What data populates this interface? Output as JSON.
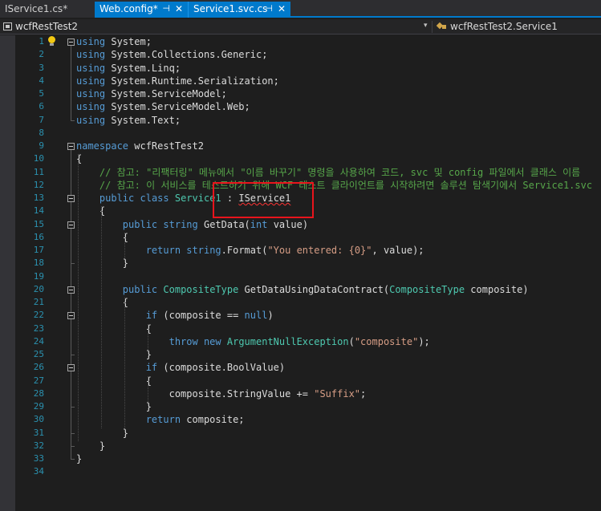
{
  "tabs": [
    {
      "label": "IService1.cs*"
    },
    {
      "label": "Web.config*",
      "pin": "⊣",
      "close": "✕"
    },
    {
      "label": "Service1.svc.cs",
      "pin": "⊣",
      "close": "✕"
    }
  ],
  "navbar": {
    "project": "wcfRestTest2",
    "member": "wcfRestTest2.Service1",
    "dropdown_glyph": "▾"
  },
  "editor": {
    "line_numbers": [
      "1",
      "2",
      "3",
      "4",
      "5",
      "6",
      "7",
      "8",
      "9",
      "10",
      "11",
      "12",
      "13",
      "14",
      "15",
      "16",
      "17",
      "18",
      "19",
      "20",
      "21",
      "22",
      "23",
      "24",
      "25",
      "26",
      "27",
      "28",
      "29",
      "30",
      "31",
      "32",
      "33",
      "34"
    ],
    "lines": [
      [
        {
          "c": "kw",
          "t": "using"
        },
        {
          "c": "tx",
          "t": " System;"
        }
      ],
      [
        {
          "c": "kw",
          "t": "using"
        },
        {
          "c": "tx",
          "t": " System.Collections.Generic;"
        }
      ],
      [
        {
          "c": "kw",
          "t": "using"
        },
        {
          "c": "tx",
          "t": " System.Linq;"
        }
      ],
      [
        {
          "c": "kw",
          "t": "using"
        },
        {
          "c": "tx",
          "t": " System.Runtime.Serialization;"
        }
      ],
      [
        {
          "c": "kw",
          "t": "using"
        },
        {
          "c": "tx",
          "t": " System.ServiceModel;"
        }
      ],
      [
        {
          "c": "kw",
          "t": "using"
        },
        {
          "c": "tx",
          "t": " System.ServiceModel.Web;"
        }
      ],
      [
        {
          "c": "kw",
          "t": "using"
        },
        {
          "c": "tx",
          "t": " System.Text;"
        }
      ],
      [],
      [
        {
          "c": "kw",
          "t": "namespace"
        },
        {
          "c": "tx",
          "t": " wcfRestTest2"
        }
      ],
      [
        {
          "c": "tx",
          "t": "{"
        }
      ],
      [
        {
          "c": "cm",
          "t": "    // 참고: \"리팩터링\" 메뉴에서 \"이름 바꾸기\" 명령을 사용하여 코드, svc 및 config 파일에서 클래스 이름"
        }
      ],
      [
        {
          "c": "cm",
          "t": "    // 참고: 이 서비스를 테스트하기 위해 WCF 테스트 클라이언트를 시작하려면 솔루션 탐색기에서 Service1.svc"
        }
      ],
      [
        {
          "c": "tx",
          "t": "    "
        },
        {
          "c": "kw",
          "t": "public"
        },
        {
          "c": "tx",
          "t": " "
        },
        {
          "c": "kw",
          "t": "class"
        },
        {
          "c": "tx",
          "t": " "
        },
        {
          "c": "ty",
          "t": "Service1"
        },
        {
          "c": "tx",
          "t": " : "
        },
        {
          "c": "tx squiggle",
          "t": "IService1"
        }
      ],
      [
        {
          "c": "tx",
          "t": "    {"
        }
      ],
      [
        {
          "c": "tx",
          "t": "        "
        },
        {
          "c": "kw",
          "t": "public"
        },
        {
          "c": "tx",
          "t": " "
        },
        {
          "c": "kw",
          "t": "string"
        },
        {
          "c": "tx",
          "t": " GetData("
        },
        {
          "c": "kw",
          "t": "int"
        },
        {
          "c": "tx",
          "t": " value)"
        }
      ],
      [
        {
          "c": "tx",
          "t": "        {"
        }
      ],
      [
        {
          "c": "tx",
          "t": "            "
        },
        {
          "c": "kw",
          "t": "return"
        },
        {
          "c": "tx",
          "t": " "
        },
        {
          "c": "kw",
          "t": "string"
        },
        {
          "c": "tx",
          "t": ".Format("
        },
        {
          "c": "st",
          "t": "\"You entered: {0}\""
        },
        {
          "c": "tx",
          "t": ", value);"
        }
      ],
      [
        {
          "c": "tx",
          "t": "        }"
        }
      ],
      [],
      [
        {
          "c": "tx",
          "t": "        "
        },
        {
          "c": "kw",
          "t": "public"
        },
        {
          "c": "tx",
          "t": " "
        },
        {
          "c": "ty",
          "t": "CompositeType"
        },
        {
          "c": "tx",
          "t": " GetDataUsingDataContract("
        },
        {
          "c": "ty",
          "t": "CompositeType"
        },
        {
          "c": "tx",
          "t": " composite)"
        }
      ],
      [
        {
          "c": "tx",
          "t": "        {"
        }
      ],
      [
        {
          "c": "tx",
          "t": "            "
        },
        {
          "c": "kw",
          "t": "if"
        },
        {
          "c": "tx",
          "t": " (composite == "
        },
        {
          "c": "kw",
          "t": "null"
        },
        {
          "c": "tx",
          "t": ")"
        }
      ],
      [
        {
          "c": "tx",
          "t": "            {"
        }
      ],
      [
        {
          "c": "tx",
          "t": "                "
        },
        {
          "c": "kw",
          "t": "throw"
        },
        {
          "c": "tx",
          "t": " "
        },
        {
          "c": "kw",
          "t": "new"
        },
        {
          "c": "tx",
          "t": " "
        },
        {
          "c": "ty",
          "t": "ArgumentNullException"
        },
        {
          "c": "tx",
          "t": "("
        },
        {
          "c": "st",
          "t": "\"composite\""
        },
        {
          "c": "tx",
          "t": ");"
        }
      ],
      [
        {
          "c": "tx",
          "t": "            }"
        }
      ],
      [
        {
          "c": "tx",
          "t": "            "
        },
        {
          "c": "kw",
          "t": "if"
        },
        {
          "c": "tx",
          "t": " (composite.BoolValue)"
        }
      ],
      [
        {
          "c": "tx",
          "t": "            {"
        }
      ],
      [
        {
          "c": "tx",
          "t": "                composite.StringValue += "
        },
        {
          "c": "st",
          "t": "\"Suffix\""
        },
        {
          "c": "tx",
          "t": ";"
        }
      ],
      [
        {
          "c": "tx",
          "t": "            }"
        }
      ],
      [
        {
          "c": "tx",
          "t": "            "
        },
        {
          "c": "kw",
          "t": "return"
        },
        {
          "c": "tx",
          "t": " composite;"
        }
      ],
      [
        {
          "c": "tx",
          "t": "        }"
        }
      ],
      [
        {
          "c": "tx",
          "t": "    }"
        }
      ],
      [
        {
          "c": "tx",
          "t": "}"
        }
      ],
      []
    ]
  },
  "colors": {
    "keyword": "#569cd6",
    "type": "#4ec9b0",
    "string": "#d69d85",
    "comment": "#57a64a",
    "highlight_box": "#e8141c",
    "active_tab": "#007acc"
  },
  "icons": {
    "lightbulb": "lightbulb-icon",
    "project": "project-icon",
    "class": "class-icon"
  }
}
